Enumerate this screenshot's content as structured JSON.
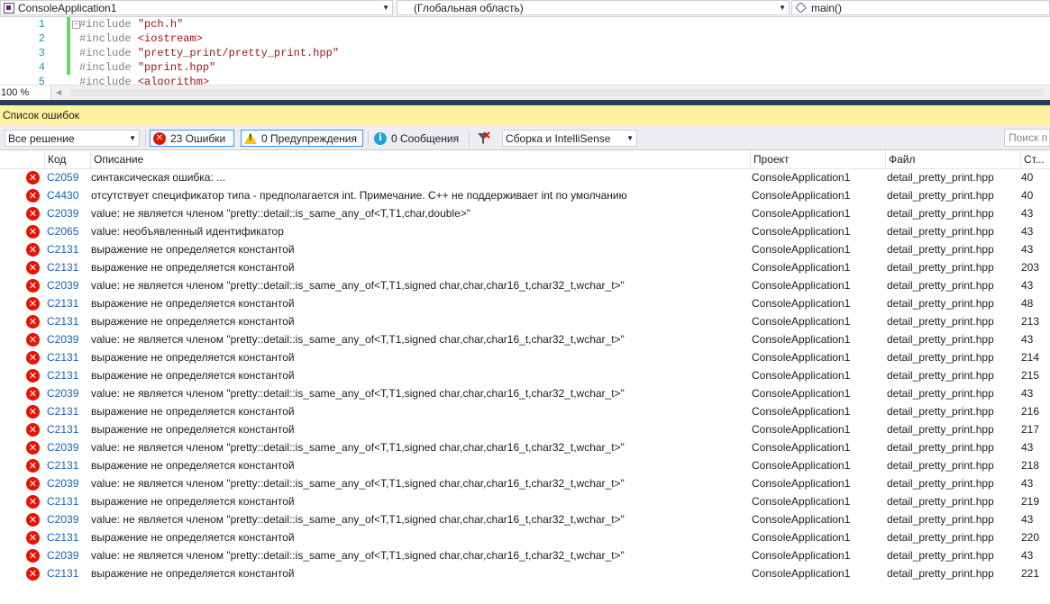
{
  "nav": {
    "project": "ConsoleApplication1",
    "scope": "(Глобальная область)",
    "member": "main()"
  },
  "editor": {
    "lines": [
      {
        "num": "1",
        "kw": "#include ",
        "arg": "\"pch.h\"",
        "arg_is_string": true
      },
      {
        "num": "2",
        "kw": "#include ",
        "arg": "<iostream>",
        "arg_is_string": true
      },
      {
        "num": "3",
        "kw": "#include ",
        "arg": "\"pretty_print/pretty_print.hpp\"",
        "arg_is_string": true
      },
      {
        "num": "4",
        "kw": "#include ",
        "arg": "\"pprint.hpp\"",
        "arg_is_string": true
      },
      {
        "num": "5",
        "kw": "#include ",
        "arg": "<algorithm>",
        "arg_is_string": true
      }
    ],
    "zoom": "100 %"
  },
  "errorlist": {
    "title": "Список ошибок",
    "scope_filter": "Все решение",
    "errors_label": "23 Ошибки",
    "warnings_label": "0 Предупреждения",
    "messages_label": "0 Сообщения",
    "build_filter": "Сборка и IntelliSense",
    "search_placeholder": "Поиск п",
    "columns": {
      "code": "Код",
      "description": "Описание",
      "project": "Проект",
      "file": "Файл",
      "line": "Ст..."
    },
    "rows": [
      {
        "code": "C2059",
        "description": "синтаксическая ошибка: ...",
        "project": "ConsoleApplication1",
        "file": "detail_pretty_print.hpp",
        "line": "40"
      },
      {
        "code": "C4430",
        "description": "отсутствует спецификатор типа - предполагается int. Примечание. C++ не поддерживает int по умолчанию",
        "project": "ConsoleApplication1",
        "file": "detail_pretty_print.hpp",
        "line": "40"
      },
      {
        "code": "C2039",
        "description": "value: не является членом \"pretty::detail::is_same_any_of<T,T1,char,double>\"",
        "project": "ConsoleApplication1",
        "file": "detail_pretty_print.hpp",
        "line": "43"
      },
      {
        "code": "C2065",
        "description": "value: необъявленный идентификатор",
        "project": "ConsoleApplication1",
        "file": "detail_pretty_print.hpp",
        "line": "43"
      },
      {
        "code": "C2131",
        "description": "выражение не определяется константой",
        "project": "ConsoleApplication1",
        "file": "detail_pretty_print.hpp",
        "line": "43"
      },
      {
        "code": "C2131",
        "description": "выражение не определяется константой",
        "project": "ConsoleApplication1",
        "file": "detail_pretty_print.hpp",
        "line": "203"
      },
      {
        "code": "C2039",
        "description": "value: не является членом \"pretty::detail::is_same_any_of<T,T1,signed char,char,char16_t,char32_t,wchar_t>\"",
        "project": "ConsoleApplication1",
        "file": "detail_pretty_print.hpp",
        "line": "43"
      },
      {
        "code": "C2131",
        "description": "выражение не определяется константой",
        "project": "ConsoleApplication1",
        "file": "detail_pretty_print.hpp",
        "line": "48"
      },
      {
        "code": "C2131",
        "description": "выражение не определяется константой",
        "project": "ConsoleApplication1",
        "file": "detail_pretty_print.hpp",
        "line": "213"
      },
      {
        "code": "C2039",
        "description": "value: не является членом \"pretty::detail::is_same_any_of<T,T1,signed char,char,char16_t,char32_t,wchar_t>\"",
        "project": "ConsoleApplication1",
        "file": "detail_pretty_print.hpp",
        "line": "43"
      },
      {
        "code": "C2131",
        "description": "выражение не определяется константой",
        "project": "ConsoleApplication1",
        "file": "detail_pretty_print.hpp",
        "line": "214"
      },
      {
        "code": "C2131",
        "description": "выражение не определяется константой",
        "project": "ConsoleApplication1",
        "file": "detail_pretty_print.hpp",
        "line": "215"
      },
      {
        "code": "C2039",
        "description": "value: не является членом \"pretty::detail::is_same_any_of<T,T1,signed char,char,char16_t,char32_t,wchar_t>\"",
        "project": "ConsoleApplication1",
        "file": "detail_pretty_print.hpp",
        "line": "43"
      },
      {
        "code": "C2131",
        "description": "выражение не определяется константой",
        "project": "ConsoleApplication1",
        "file": "detail_pretty_print.hpp",
        "line": "216"
      },
      {
        "code": "C2131",
        "description": "выражение не определяется константой",
        "project": "ConsoleApplication1",
        "file": "detail_pretty_print.hpp",
        "line": "217"
      },
      {
        "code": "C2039",
        "description": "value: не является членом \"pretty::detail::is_same_any_of<T,T1,signed char,char,char16_t,char32_t,wchar_t>\"",
        "project": "ConsoleApplication1",
        "file": "detail_pretty_print.hpp",
        "line": "43"
      },
      {
        "code": "C2131",
        "description": "выражение не определяется константой",
        "project": "ConsoleApplication1",
        "file": "detail_pretty_print.hpp",
        "line": "218"
      },
      {
        "code": "C2039",
        "description": "value: не является членом \"pretty::detail::is_same_any_of<T,T1,signed char,char,char16_t,char32_t,wchar_t>\"",
        "project": "ConsoleApplication1",
        "file": "detail_pretty_print.hpp",
        "line": "43"
      },
      {
        "code": "C2131",
        "description": "выражение не определяется константой",
        "project": "ConsoleApplication1",
        "file": "detail_pretty_print.hpp",
        "line": "219"
      },
      {
        "code": "C2039",
        "description": "value: не является членом \"pretty::detail::is_same_any_of<T,T1,signed char,char,char16_t,char32_t,wchar_t>\"",
        "project": "ConsoleApplication1",
        "file": "detail_pretty_print.hpp",
        "line": "43"
      },
      {
        "code": "C2131",
        "description": "выражение не определяется константой",
        "project": "ConsoleApplication1",
        "file": "detail_pretty_print.hpp",
        "line": "220"
      },
      {
        "code": "C2039",
        "description": "value: не является членом \"pretty::detail::is_same_any_of<T,T1,signed char,char,char16_t,char32_t,wchar_t>\"",
        "project": "ConsoleApplication1",
        "file": "detail_pretty_print.hpp",
        "line": "43"
      },
      {
        "code": "C2131",
        "description": "выражение не определяется константой",
        "project": "ConsoleApplication1",
        "file": "detail_pretty_print.hpp",
        "line": "221"
      }
    ]
  },
  "colors": {
    "error": "#e51400",
    "warning": "#f5c518",
    "info": "#1ba1e2",
    "title_bar": "#fff29d",
    "splitter": "#2d3b5a"
  }
}
